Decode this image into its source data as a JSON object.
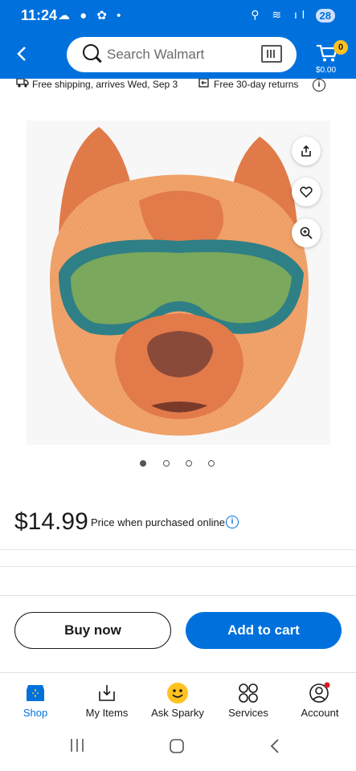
{
  "status_bar": {
    "time": "11:24",
    "left_icons": "☁ ● ✿ •",
    "right_icons": "⚲ ≋ ıl",
    "battery": "28"
  },
  "header": {
    "back_icon": "chevron-left-icon",
    "search_placeholder": "Search Walmart",
    "cart_count": "0",
    "cart_total": "$0.00"
  },
  "shipping": {
    "free_shipping": "Free shipping, arrives Wed, Sep 3",
    "free_returns": "Free 30-day returns"
  },
  "gallery": {
    "dot_count": 4,
    "active_dot": 0
  },
  "price": {
    "amount": "$14.99",
    "note": "Price when purchased online"
  },
  "actions": {
    "buy_now": "Buy now",
    "add_to_cart": "Add to cart"
  },
  "tabs": [
    {
      "label": "Shop",
      "icon": "shop-icon",
      "active": true
    },
    {
      "label": "My Items",
      "icon": "my-items-icon",
      "active": false
    },
    {
      "label": "Ask Sparky",
      "icon": "sparky-icon",
      "active": false
    },
    {
      "label": "Services",
      "icon": "services-icon",
      "active": false
    },
    {
      "label": "Account",
      "icon": "account-icon",
      "active": false
    }
  ],
  "colors": {
    "brand_blue": "#0071dc",
    "spark_yellow": "#ffc220"
  }
}
